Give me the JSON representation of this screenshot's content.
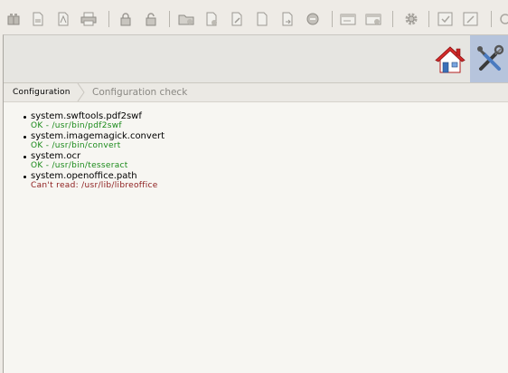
{
  "toolbar": {
    "groups": [
      [
        "box-icon",
        "doc-icon",
        "doc-pdf-icon",
        "printer-icon"
      ],
      [
        "lock-icon",
        "lock-open-icon"
      ],
      [
        "folder-new-icon",
        "doc-new-icon",
        "doc-edit-icon",
        "doc-plain-icon",
        "doc-arrow-icon",
        "remove-icon"
      ],
      [
        "card-icon",
        "card-edit-icon"
      ],
      [
        "gear-icon"
      ],
      [
        "window-check-icon",
        "window-edit-icon"
      ],
      [
        "refresh-icon"
      ]
    ]
  },
  "topbar": {
    "home_icon": "home-icon",
    "tools_icon": "tools-icon"
  },
  "breadcrumb": {
    "items": [
      "Configuration",
      "Configuration check"
    ]
  },
  "checks": [
    {
      "key": "system.swftools.pdf2swf",
      "result": "OK - /usr/bin/pdf2swf",
      "status": "ok"
    },
    {
      "key": "system.imagemagick.convert",
      "result": "OK - /usr/bin/convert",
      "status": "ok"
    },
    {
      "key": "system.ocr",
      "result": "OK - /usr/bin/tesseract",
      "status": "ok"
    },
    {
      "key": "system.openoffice.path",
      "result": "Can't read: /usr/lib/libreoffice",
      "status": "error"
    }
  ],
  "colors": {
    "ok": "#1a8a1a",
    "error": "#8b1a1a",
    "active_tool_bg": "#b6c4dc"
  }
}
